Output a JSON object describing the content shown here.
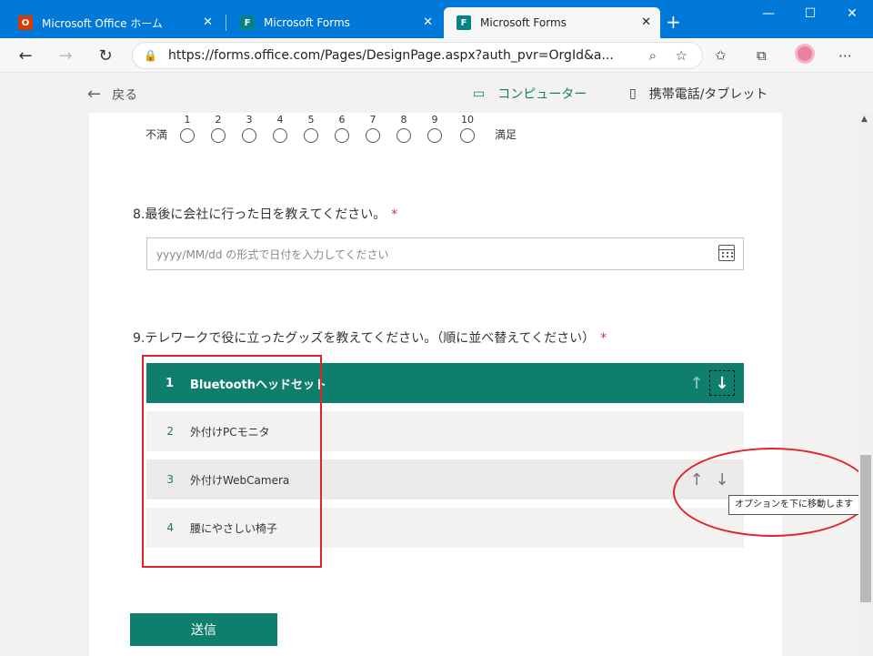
{
  "browser": {
    "tabs": [
      {
        "title": "Microsoft Office ホーム",
        "icon": "office-icon",
        "color": "#d83b01"
      },
      {
        "title": "Microsoft Forms",
        "icon": "forms-icon",
        "color": "#038387"
      },
      {
        "title": "Microsoft Forms",
        "icon": "forms-icon",
        "color": "#038387"
      }
    ],
    "new_tab": "+",
    "close_glyph": "✕",
    "url": "https://forms.office.com/Pages/DesignPage.aspx?auth_pvr=OrgId&a...",
    "window_controls": {
      "minimize": "—",
      "maximize": "☐",
      "close": "✕"
    }
  },
  "preview": {
    "back_label": "戻る",
    "desktop_label": "コンピューター",
    "mobile_label": "携帯電話/タブレット",
    "accent_color": "#0f7e6c"
  },
  "form": {
    "scale": {
      "low_label": "不満",
      "high_label": "満足",
      "numbers": [
        "1",
        "2",
        "3",
        "4",
        "5",
        "6",
        "7",
        "8",
        "9",
        "10"
      ]
    },
    "q8": {
      "title": "8.最後に会社に行った日を教えてください。",
      "required": "*",
      "placeholder": "yyyy/MM/dd の形式で日付を入力してください"
    },
    "q9": {
      "title": "9.テレワークで役に立ったグッズを教えてください。（順に並べ替えてください）",
      "required": "*",
      "items": [
        {
          "index": "1",
          "label": "Bluetoothヘッドセット"
        },
        {
          "index": "2",
          "label": "外付けPCモニタ"
        },
        {
          "index": "3",
          "label": "外付けWebCamera"
        },
        {
          "index": "4",
          "label": "腰にやさしい椅子"
        }
      ],
      "up_glyph": "↑",
      "down_glyph": "↓"
    },
    "submit_label": "送信"
  },
  "tooltip": "オプションを下に移動します",
  "annotation_color": "#e0242c"
}
